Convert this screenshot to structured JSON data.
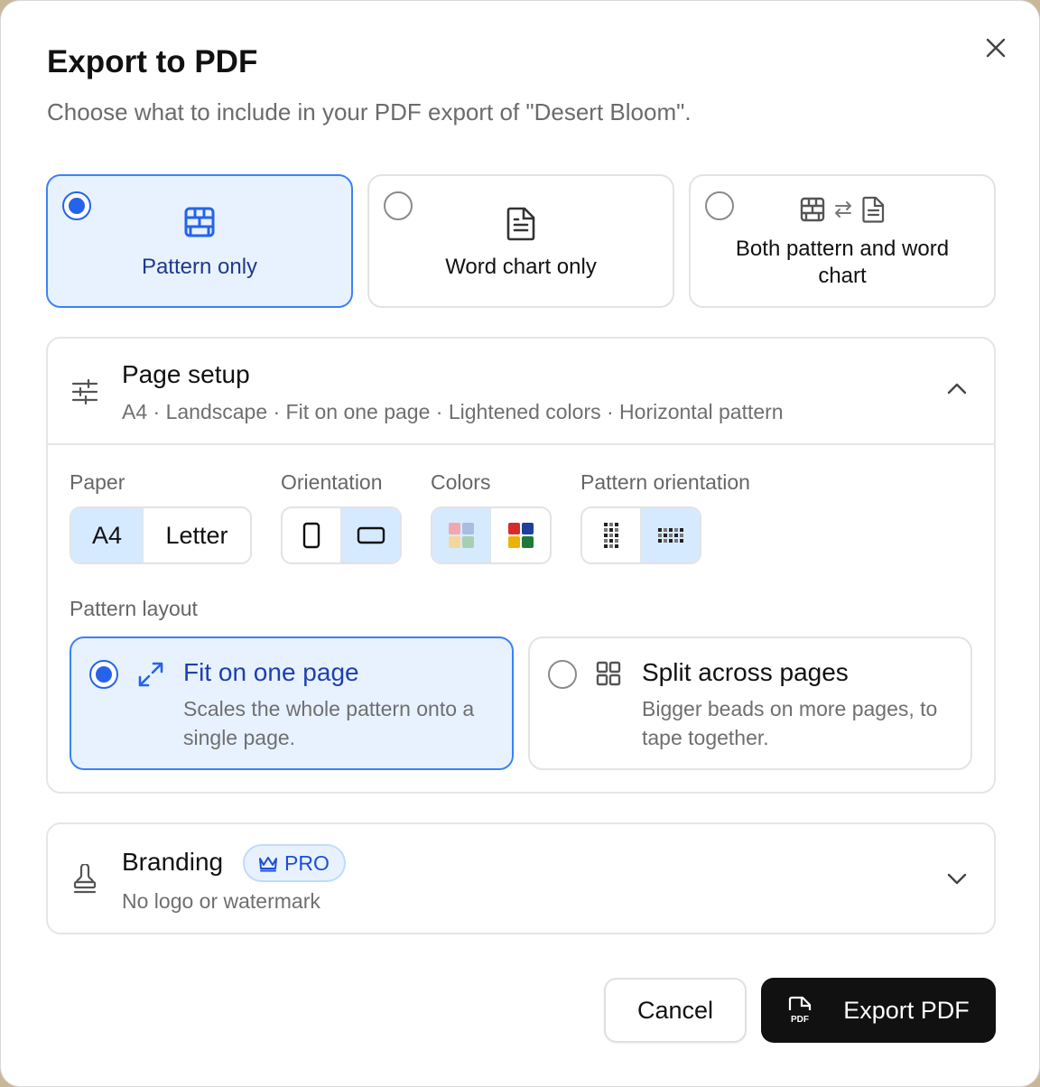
{
  "dialog": {
    "title": "Export to PDF",
    "subtitle": "Choose what to include in your PDF export of \"Desert Bloom\"."
  },
  "content_options": [
    {
      "label": "Pattern only",
      "selected": true,
      "icon": "bead-grid-icon"
    },
    {
      "label": "Word chart only",
      "selected": false,
      "icon": "document-icon"
    },
    {
      "label": "Both pattern and word chart",
      "selected": false,
      "icon": "grid-swap-document-icon"
    }
  ],
  "page_setup": {
    "title": "Page setup",
    "summary": "A4 · Landscape · Fit on one page · Lightened colors · Horizontal pattern",
    "expanded": true,
    "paper": {
      "label": "Paper",
      "options": [
        "A4",
        "Letter"
      ],
      "selected": "A4"
    },
    "orientation": {
      "label": "Orientation",
      "options": [
        "portrait-icon",
        "landscape-icon"
      ],
      "selected": "landscape-icon"
    },
    "colors": {
      "label": "Colors",
      "options": [
        "lightened-colors-icon",
        "full-colors-icon"
      ],
      "selected": "lightened-colors-icon"
    },
    "pattern_orientation": {
      "label": "Pattern orientation",
      "options": [
        "vertical-pattern-icon",
        "horizontal-pattern-icon"
      ],
      "selected": "horizontal-pattern-icon"
    },
    "pattern_layout": {
      "label": "Pattern layout",
      "options": [
        {
          "title": "Fit on one page",
          "desc": "Scales the whole pattern onto a single page.",
          "selected": true,
          "icon": "expand-arrows-icon"
        },
        {
          "title": "Split across pages",
          "desc": "Bigger beads on more pages, to tape together.",
          "selected": false,
          "icon": "grid-four-icon"
        }
      ]
    }
  },
  "branding": {
    "title": "Branding",
    "badge": "PRO",
    "summary": "No logo or watermark",
    "expanded": false
  },
  "footer": {
    "cancel": "Cancel",
    "export": "Export PDF",
    "export_icon_text": "PDF"
  },
  "colors": {
    "accent": "#2563eb",
    "selected_bg": "#e8f2ff",
    "segment_active_bg": "#d6eaff",
    "primary_button": "#111111"
  }
}
